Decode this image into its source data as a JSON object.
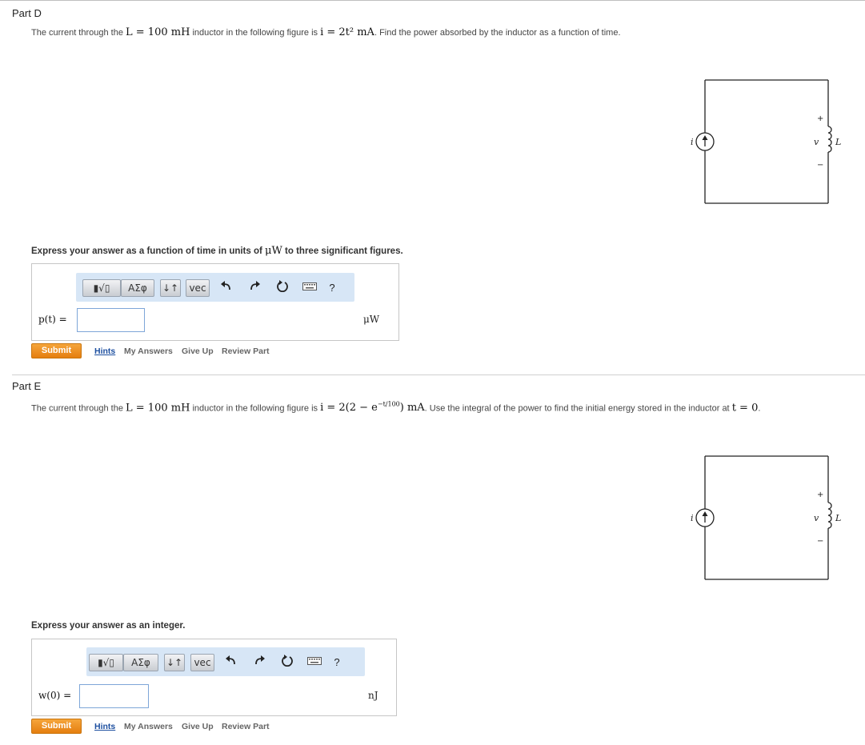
{
  "partD": {
    "title": "Part D",
    "prompt_pre": "The current through the ",
    "prompt_math1": "L = 100 mH",
    "prompt_mid": " inductor in the following figure is ",
    "prompt_math2": "i = 2t² mA",
    "prompt_post": ". Find the power absorbed by the inductor as a function of time.",
    "express_pre": "Express your answer as a function of time in units of ",
    "express_math": "μW",
    "express_post": " to three significant figures.",
    "var_label": "p(t) =",
    "answer_value": "",
    "unit": "μW",
    "submit": "Submit",
    "links": [
      "Hints",
      "My Answers",
      "Give Up",
      "Review Part"
    ]
  },
  "partE": {
    "title": "Part E",
    "prompt_pre": "The current through the ",
    "prompt_math1": "L = 100 mH",
    "prompt_mid": " inductor in the following figure is ",
    "prompt_math2": "i = 2(2 − e",
    "prompt_math2_sup": "−t/100",
    "prompt_math2_end": ") mA",
    "prompt_post": ". Use the integral of the power to find the initial energy stored in the inductor at ",
    "prompt_math3": "t = 0",
    "prompt_end": ".",
    "express": "Express your answer as an integer.",
    "var_label": "w(0) =",
    "answer_value": "",
    "unit": "nJ",
    "submit": "Submit",
    "links": [
      "Hints",
      "My Answers",
      "Give Up",
      "Review Part"
    ]
  },
  "toolbar": {
    "templates_label": "▮√▯",
    "greek_label": "ΑΣφ",
    "arrows_label": "↓↑",
    "vec_label": "vec",
    "help_label": "?",
    "icons": [
      "undo-icon",
      "redo-icon",
      "reset-icon",
      "keyboard-icon",
      "help-icon"
    ]
  },
  "circuit": {
    "source_label": "i",
    "voltage_label": "v",
    "plus": "+",
    "minus": "−",
    "inductor_label": "L"
  },
  "colors": {
    "toolbar_bg": "#d7e6f6",
    "submit": "#ef8f1e",
    "link": "#1d4fa0",
    "input_border": "#7ea6d8"
  }
}
